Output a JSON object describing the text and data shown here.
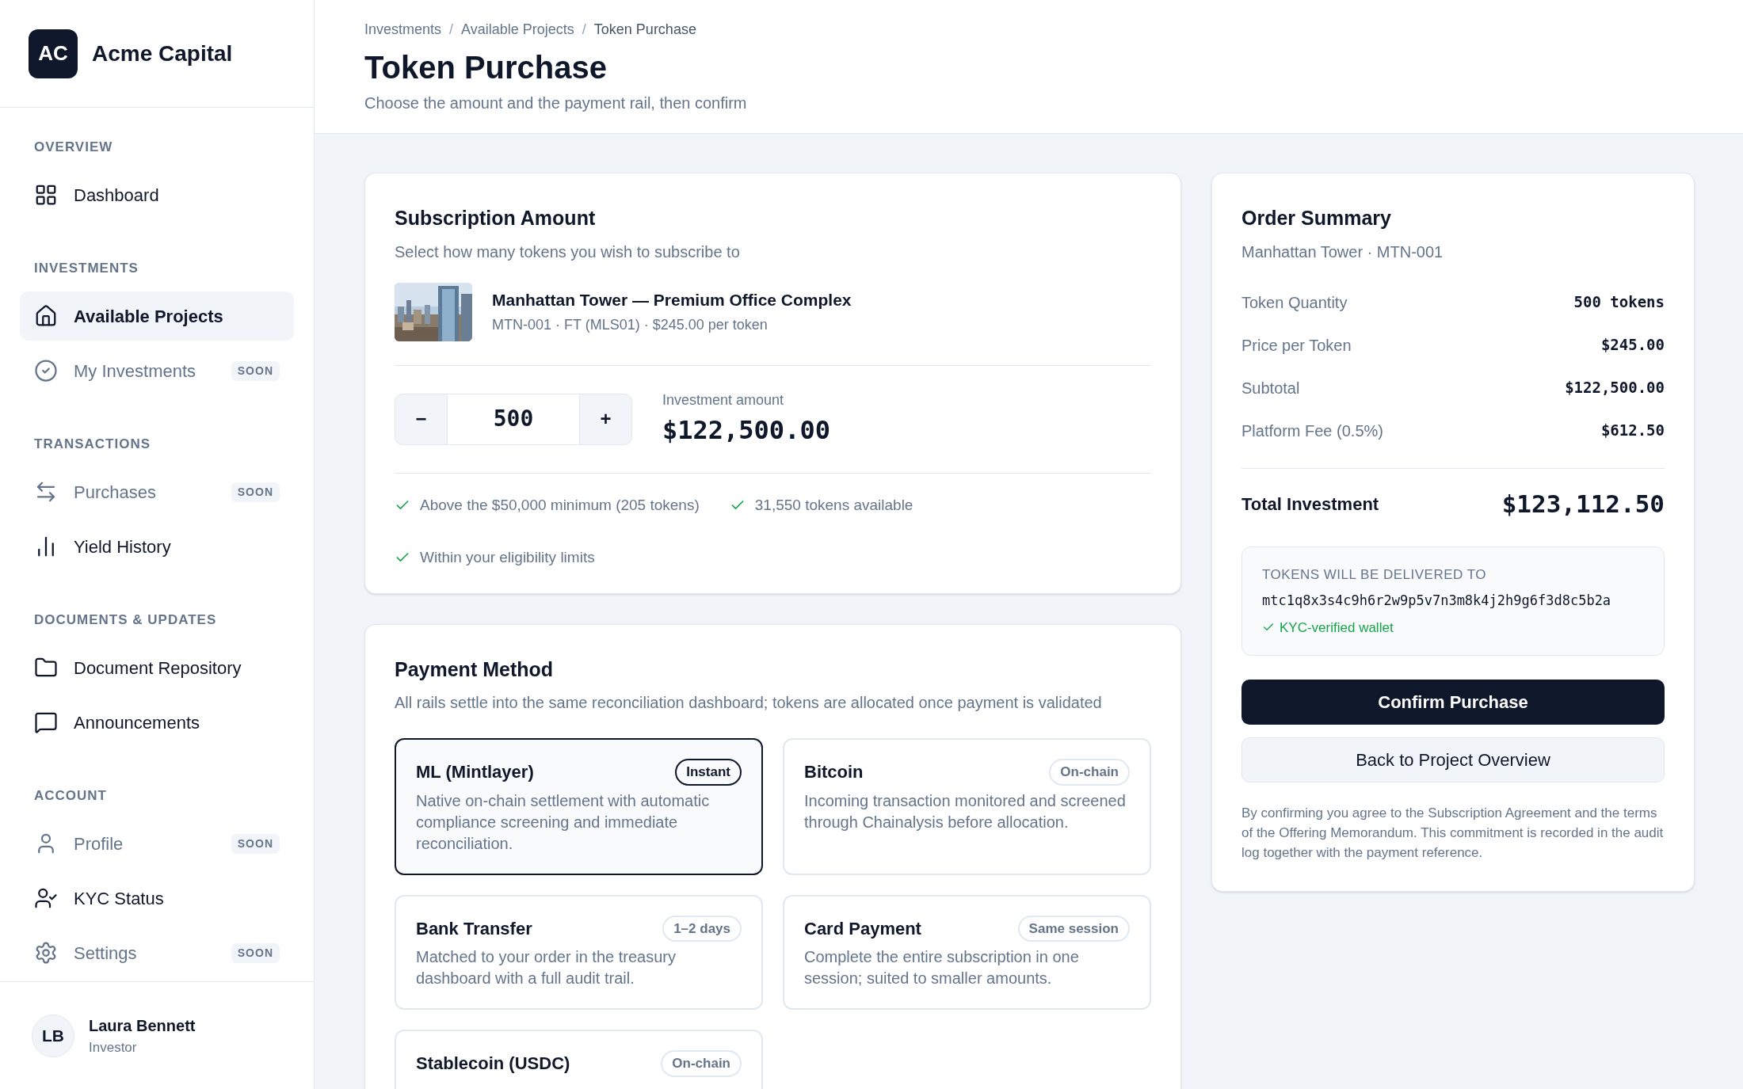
{
  "brand": {
    "initials": "AC",
    "name": "Acme Capital"
  },
  "sidebar": {
    "sections": [
      {
        "label": "OVERVIEW",
        "items": [
          {
            "label": "Dashboard",
            "selected": false,
            "disabled": false
          }
        ]
      },
      {
        "label": "INVESTMENTS",
        "items": [
          {
            "label": "Available Projects",
            "selected": true,
            "disabled": false
          },
          {
            "label": "My Investments",
            "selected": false,
            "disabled": true,
            "badge": "SOON"
          }
        ]
      },
      {
        "label": "TRANSACTIONS",
        "items": [
          {
            "label": "Purchases",
            "selected": false,
            "disabled": true,
            "badge": "SOON"
          },
          {
            "label": "Yield History",
            "selected": false,
            "disabled": false
          }
        ]
      },
      {
        "label": "DOCUMENTS & UPDATES",
        "items": [
          {
            "label": "Document Repository",
            "selected": false,
            "disabled": false
          },
          {
            "label": "Announcements",
            "selected": false,
            "disabled": false
          }
        ]
      },
      {
        "label": "ACCOUNT",
        "items": [
          {
            "label": "Profile",
            "selected": false,
            "disabled": true,
            "badge": "SOON"
          },
          {
            "label": "KYC Status",
            "selected": false,
            "disabled": false
          },
          {
            "label": "Settings",
            "selected": false,
            "disabled": true,
            "badge": "SOON"
          }
        ]
      }
    ]
  },
  "user": {
    "initials": "LB",
    "name": "Laura Bennett",
    "role": "Investor"
  },
  "breadcrumb": {
    "separator": "/",
    "items": [
      "Investments",
      "Available Projects",
      "Token Purchase"
    ]
  },
  "page": {
    "title": "Token Purchase",
    "subtitle": "Choose the amount and the payment rail, then confirm"
  },
  "subscription": {
    "title": "Subscription Amount",
    "subtitle": "Select how many tokens you wish to subscribe to",
    "project": {
      "name": "Manhattan Tower — Premium Office Complex",
      "meta": "MTN-001 · FT (MLS01) · $245.00 per token"
    },
    "stepper": {
      "minus": "−",
      "value": "500",
      "plus": "+"
    },
    "amount_label": "Investment amount",
    "amount": "$122,500.00",
    "checks": [
      "Above the $50,000 minimum (205 tokens)",
      "31,550 tokens available",
      "Within your eligibility limits"
    ]
  },
  "payment": {
    "title": "Payment Method",
    "subtitle": "All rails settle into the same reconciliation dashboard; tokens are allocated once payment is validated",
    "methods": [
      {
        "name": "ML (Mintlayer)",
        "tag": "Instant",
        "description": "Native on-chain settlement with automatic compliance screening and immediate reconciliation.",
        "selected": true
      },
      {
        "name": "Bitcoin",
        "tag": "On-chain",
        "description": "Incoming transaction monitored and screened through Chainalysis before allocation.",
        "selected": false
      },
      {
        "name": "Bank Transfer",
        "tag": "1–2 days",
        "description": "Matched to your order in the treasury dashboard with a full audit trail.",
        "selected": false
      },
      {
        "name": "Card Payment",
        "tag": "Same session",
        "description": "Complete the entire subscription in one session; suited to smaller amounts.",
        "selected": false
      },
      {
        "name": "Stablecoin (USDC)",
        "tag": "On-chain",
        "selected": false
      }
    ]
  },
  "summary": {
    "title": "Order Summary",
    "subtitle": "Manhattan Tower · MTN-001",
    "rows": [
      {
        "label": "Token Quantity",
        "value": "500 tokens"
      },
      {
        "label": "Price per Token",
        "value": "$245.00"
      },
      {
        "label": "Subtotal",
        "value": "$122,500.00"
      },
      {
        "label": "Platform Fee (0.5%)",
        "value": "$612.50"
      }
    ],
    "total_label": "Total Investment",
    "total": "$123,112.50",
    "delivery": {
      "label": "TOKENS WILL BE DELIVERED TO",
      "address": "mtc1q8x3s4c9h6r2w9p5v7n3m8k4j2h9g6f3d8c5b2a",
      "verified": "KYC-verified wallet"
    },
    "confirm": "Confirm Purchase",
    "back": "Back to Project Overview",
    "disclaimer": "By confirming you agree to the Subscription Agreement and the terms of the Offering Memorandum. This commitment is recorded in the audit log together with the payment reference."
  }
}
